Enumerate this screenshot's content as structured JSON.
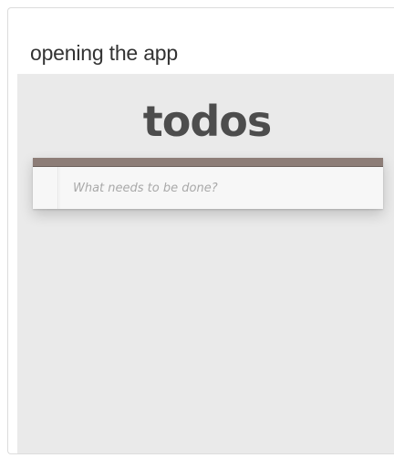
{
  "caption": "opening the app",
  "app": {
    "title": "todos",
    "new_todo": {
      "value": "",
      "placeholder": "What needs to be done?"
    }
  },
  "colors": {
    "header_bar": "#8d7d77",
    "app_background": "#eaeaea",
    "title": "#4d4d4d"
  }
}
